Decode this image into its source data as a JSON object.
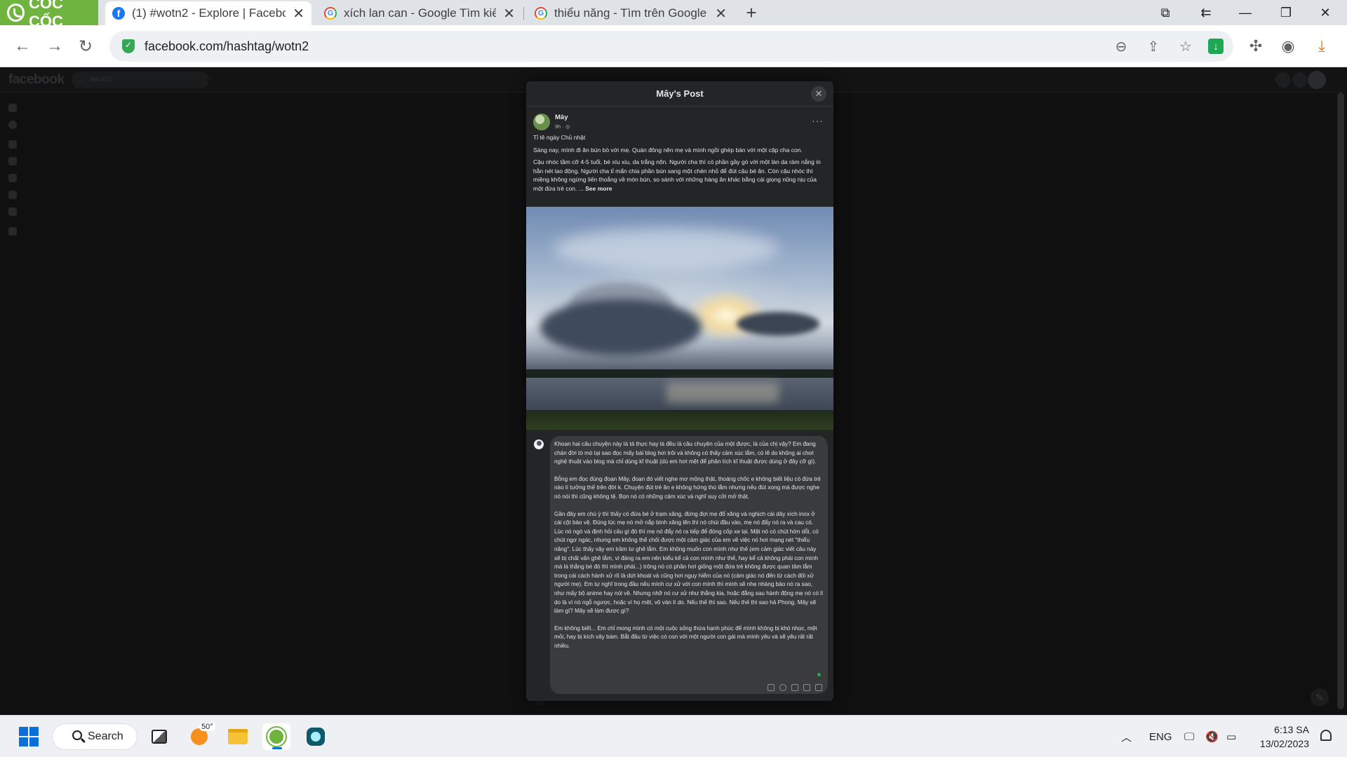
{
  "browser": {
    "brand_label": "CỐC CỐC",
    "tabs": [
      {
        "title": "(1) #wotn2 - Explore | Facebook",
        "favicon": "facebook-icon",
        "active": true
      },
      {
        "title": "xích lan can - Google Tìm kiếm",
        "favicon": "google-icon",
        "active": false
      },
      {
        "title": "thiểu năng - Tìm trên Google",
        "favicon": "google-icon",
        "active": false
      }
    ],
    "new_tab_icon": "plus-icon",
    "url": "facebook.com/hashtag/wotn2",
    "window_buttons": [
      "screen-capture-icon",
      "back-arrows-icon",
      "minimize-icon",
      "restore-icon",
      "close-icon"
    ]
  },
  "facebook": {
    "logo": "facebook",
    "search_placeholder": "#wotn2"
  },
  "modal": {
    "title": "Mây's Post",
    "author": "Mây",
    "meta": "9h · ",
    "post_title": "Tỉ tê ngày Chủ nhật",
    "paragraphs": [
      "Sáng nay, mình đi ăn bún bò với mẹ. Quán đông nên mẹ và mình ngồi ghép bàn với một cặp cha con.",
      "Cậu nhóc tầm cỡ 4-5 tuổi, bé xíu xiu, da trắng nõn. Người cha thì có phần gầy gò với một làn da rám nắng in hằn nét lao động. Người cha tỉ mẩn chia phần bún sang một chén nhỏ để đút cậu bé ăn. Còn cậu nhóc thì miệng không ngừng liến thoắng về món bún, so sánh với những hàng ăn khác bằng cái giọng nũng nịu của một đứa trẻ con. ..."
    ],
    "see_more": "See more",
    "comment": [
      "Khoan hai câu chuyện này là tả thực hay là đều là câu chuyện của một được, là của chị vậy? Em đang chán đời tò mò tại sao đọc mấy bài blog hơi trôi và không có thấy cảm xúc lắm, có lẽ do không ai chơi nghệ thuật vào blog mà chỉ dùng kĩ thuật (dù em hơi mệt để phân tích kĩ thuật được dùng ở đây cỡ gì).",
      "Bỗng em đọc đúng đoạn Mây, đoạn đó viết nghe mơ mộng thật, thoáng chốc e không biết liệu có đứa trẻ nào lí tưởng thế trên đời k. Chuyện đút trẻ ăn e không hứng thú lắm nhưng nếu đút xong mà được nghe nó nói thì cũng không tệ. Bọn nó có những cảm xúc và nghĩ suy cởi mở thật.",
      "Gần đây em chú ý thì thấy có đứa bé ở trạm xăng, đứng đợi mẹ đổ xăng và nghịch cái dây xích inox ở cái cột bảo vệ. Đúng lúc mẹ nó mở nắp bình xăng lên thì nó chúi đầu vào, mẹ nó đẩy nó ra và cau có. Lúc nó ngó và định hỏi câu gì đó thì mẹ nó đẩy nó ra tiếp để đóng cốp xe lại. Mặt nó có chút hờn dỗi, có chút ngơ ngác, nhưng em không thể chối được một cảm giác của em về việc nó hơi mang nét \"thiểu năng\". Lúc thấy vậy em trầm tư ghê lắm. Em không muốn con mình như thế (em cảm giác viết câu này sẽ bị chất vấn ghê lắm, vì đáng ra em nên kiểu kể cả con mình như thế, hay kể cả không phải con mình mà là thằng bé đó thì mình phải...) trông nó có phần hơi giống một đứa trẻ không được quan tâm lắm trong cái cách hành xử rõ là dứt khoát và cũng hơi nguy hiểm của nó (cảm giác nó đến từ cách đối xử người mẹ). Em tự nghĩ trong đầu nếu mình cư xử với con mình thì mình sẽ nhẹ nhàng bảo nó ra sao, như mấy bộ anime hay nói về. Nhưng nhỡ nó cư xử như thằng kia, hoặc đằng sau hành động mẹ nó có lí do là vì nó ngỗ ngược, hoặc vì họ mệt, vô vàn lí do. Nếu thế thì sao. Nếu thế thì sao hả Phong. Mây sẽ làm gì? Mây sẽ làm được gì?",
      "Em không biết... Em chỉ mong mình có một cuộc sống thừa hạnh phúc để mình không bị khó nhọc, mệt mỏi, hay bị kích vây bám. Bắt đầu từ việc có con với một người con gái mà mình yêu và sẽ yêu rất rất nhiều."
    ],
    "behind_text": "11h · "
  },
  "taskbar": {
    "search_label": "Search",
    "weather_temp": "50°",
    "language": "ENG",
    "time": "6:13 SA",
    "date": "13/02/2023"
  }
}
